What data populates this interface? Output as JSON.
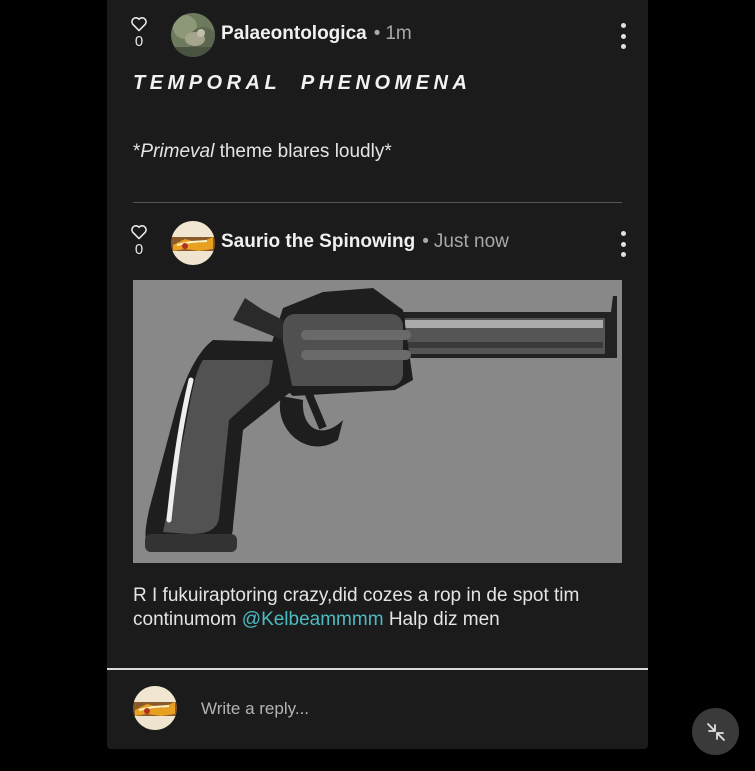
{
  "posts": [
    {
      "likes": "0",
      "author": "Palaeontologica",
      "separator": "•",
      "time": "1m",
      "headline": "TEMPORAL PHENOMENA",
      "body": {
        "lead": "*",
        "emphasis": "Primeval",
        "rest": " theme blares loudly*"
      }
    },
    {
      "likes": "0",
      "author": "Saurio the Spinowing",
      "separator": "•",
      "time": "Just now",
      "image": "revolver-image",
      "body": {
        "text": "R I fukuiraptoring crazy,did cozes a rop in de spot tim continumom ",
        "mention": "@Kelbeammmm",
        "tail": " Halp diz men"
      }
    }
  ],
  "reply": {
    "placeholder": "Write a reply..."
  },
  "icons": {
    "like": "heart-icon",
    "more": "more-vertical-icon",
    "collapse": "collapse-arrows-icon"
  },
  "colors": {
    "panel": "#1b1b1b",
    "mention": "#4bbcc2",
    "muted": "#a8a8a8"
  }
}
